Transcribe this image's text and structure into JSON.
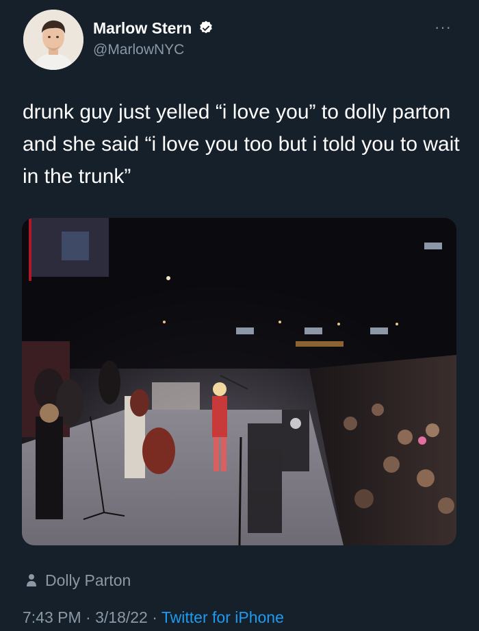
{
  "author": {
    "display_name": "Marlow Stern",
    "handle": "@MarlowNYC",
    "verified": true,
    "verified_color": "#1d9bf0"
  },
  "tweet": {
    "text": "drunk guy just yelled “i love you” to dolly parton and she said “i love you too but i told you to wait in the trunk”"
  },
  "media_tag": {
    "icon": "person-icon",
    "name": "Dolly Parton"
  },
  "meta": {
    "time": "7:43 PM",
    "separator": "·",
    "date": "3/18/22",
    "source": "Twitter for iPhone"
  },
  "more_menu": {
    "icon": "more-icon",
    "label": "···"
  },
  "colors": {
    "background": "#15202b",
    "primary_text": "#ffffff",
    "secondary_text": "#8b98a5",
    "accent": "#1d9bf0"
  }
}
